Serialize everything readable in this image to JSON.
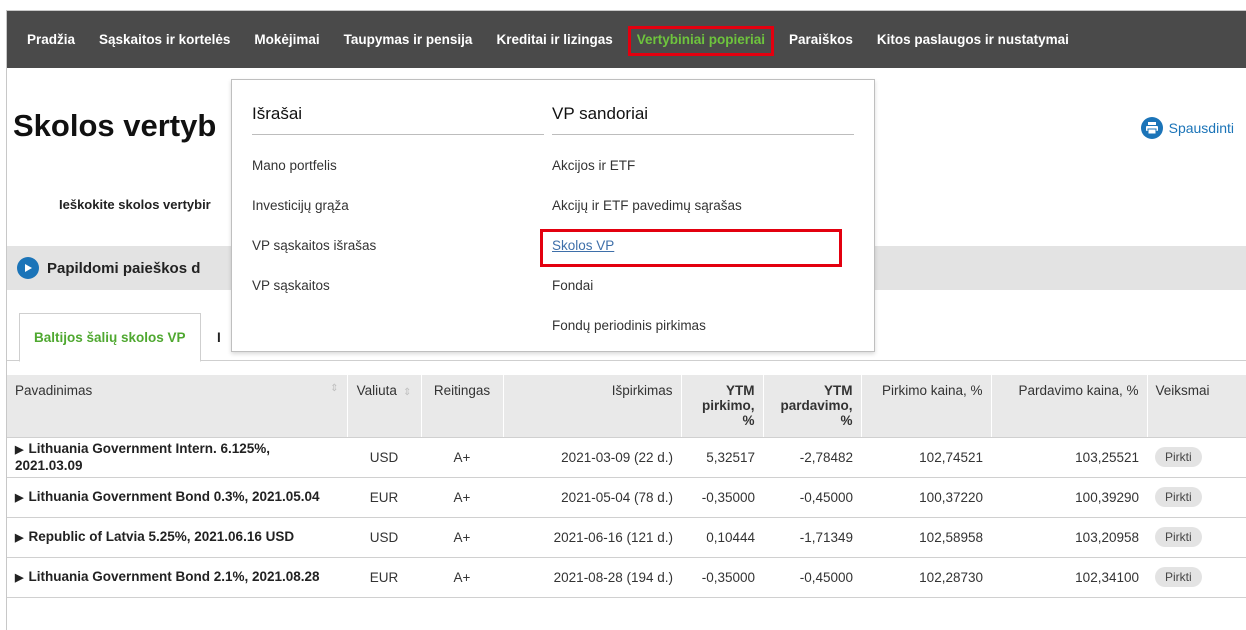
{
  "nav": {
    "items": [
      {
        "label": "Pradžia"
      },
      {
        "label": "Sąskaitos ir kortelės"
      },
      {
        "label": "Mokėjimai"
      },
      {
        "label": "Taupymas ir pensija"
      },
      {
        "label": "Kreditai ir lizingas"
      },
      {
        "label": "Vertybiniai popieriai"
      },
      {
        "label": "Paraiškos"
      },
      {
        "label": "Kitos paslaugos ir nustatymai"
      }
    ],
    "active_index": 5
  },
  "page": {
    "title": "Skolos vertyb",
    "print_label": "Spausdinti",
    "search_hint": "Ieškokite skolos vertybir",
    "advanced_search_label": "Papildomi paieškos d"
  },
  "tabs": {
    "active_label": "Baltijos šalių skolos VP",
    "second_label_fragment": "I"
  },
  "dropdown": {
    "left": {
      "title": "Išrašai",
      "links": [
        "Mano portfelis",
        "Investicijų grąža",
        "VP sąskaitos išrašas",
        "VP sąskaitos"
      ]
    },
    "right": {
      "title": "VP sandoriai",
      "links": [
        "Akcijos ir ETF",
        "Akcijų ir ETF pavedimų sąrašas",
        "Skolos VP",
        "Fondai",
        "Fondų periodinis pirkimas"
      ],
      "current_index": 2
    }
  },
  "table": {
    "headers": {
      "name": "Pavadinimas",
      "currency": "Valiuta",
      "rating": "Reitingas",
      "redemption": "Išpirkimas",
      "ytm_buy": "YTM pirkimo, %",
      "ytm_sell": "YTM pardavimo, %",
      "buy_price": "Pirkimo kaina, %",
      "sell_price": "Pardavimo kaina, %",
      "actions": "Veiksmai"
    },
    "rows": [
      {
        "name": "Lithuania Government Intern. 6.125%, 2021.03.09",
        "currency": "USD",
        "rating": "A+",
        "redemption": "2021-03-09 (22 d.)",
        "ytm_buy": "5,32517",
        "ytm_sell": "-2,78482",
        "buy_price": "102,74521",
        "sell_price": "103,25521",
        "action": "Pirkti"
      },
      {
        "name": "Lithuania Government Bond 0.3%, 2021.05.04",
        "currency": "EUR",
        "rating": "A+",
        "redemption": "2021-05-04 (78 d.)",
        "ytm_buy": "-0,35000",
        "ytm_sell": "-0,45000",
        "buy_price": "100,37220",
        "sell_price": "100,39290",
        "action": "Pirkti"
      },
      {
        "name": "Republic of Latvia 5.25%, 2021.06.16 USD",
        "currency": "USD",
        "rating": "A+",
        "redemption": "2021-06-16 (121 d.)",
        "ytm_buy": "0,10444",
        "ytm_sell": "-1,71349",
        "buy_price": "102,58958",
        "sell_price": "103,20958",
        "action": "Pirkti"
      },
      {
        "name": "Lithuania Government Bond 2.1%, 2021.08.28",
        "currency": "EUR",
        "rating": "A+",
        "redemption": "2021-08-28 (194 d.)",
        "ytm_buy": "-0,35000",
        "ytm_sell": "-0,45000",
        "buy_price": "102,28730",
        "sell_price": "102,34100",
        "action": "Pirkti"
      }
    ]
  },
  "colors": {
    "nav_bg": "#4a4a4a",
    "active_green": "#6ec43d",
    "highlight_red": "#e3000f",
    "link_blue": "#1b74b8"
  }
}
